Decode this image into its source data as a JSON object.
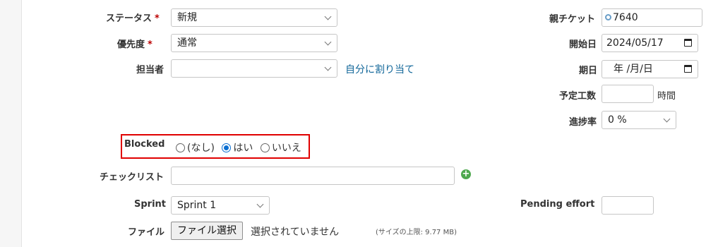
{
  "left": {
    "status": {
      "label": "ステータス",
      "required": "*",
      "value": "新規"
    },
    "priority": {
      "label": "優先度",
      "required": "*",
      "value": "通常"
    },
    "assignee": {
      "label": "担当者",
      "value": "",
      "assign_to_me": "自分に割り当て"
    },
    "blocked": {
      "label": "Blocked",
      "options": [
        {
          "label": "(なし)",
          "checked": false
        },
        {
          "label": "はい",
          "checked": true
        },
        {
          "label": "いいえ",
          "checked": false
        }
      ]
    },
    "checklist": {
      "label": "チェックリスト",
      "value": ""
    },
    "sprint": {
      "label": "Sprint",
      "value": "Sprint 1"
    },
    "file": {
      "label": "ファイル",
      "button": "ファイル選択",
      "status": "選択されていません",
      "size_note": "(サイズの上限: 9.77 MB)"
    }
  },
  "right": {
    "parent_ticket": {
      "label": "親チケット",
      "value": "7640"
    },
    "start_date": {
      "label": "開始日",
      "value": "2024/05/17"
    },
    "due_date": {
      "label": "期日",
      "value": "年 /月/日"
    },
    "estimated_time": {
      "label": "予定工数",
      "value": "",
      "unit": "時間"
    },
    "done_ratio": {
      "label": "進捗率",
      "value": "0 %"
    },
    "pending_effort": {
      "label": "Pending effort",
      "value": ""
    }
  },
  "colors": {
    "highlight_border": "#e00000",
    "link": "#116699",
    "radio_checked": "#0a6ed1"
  }
}
